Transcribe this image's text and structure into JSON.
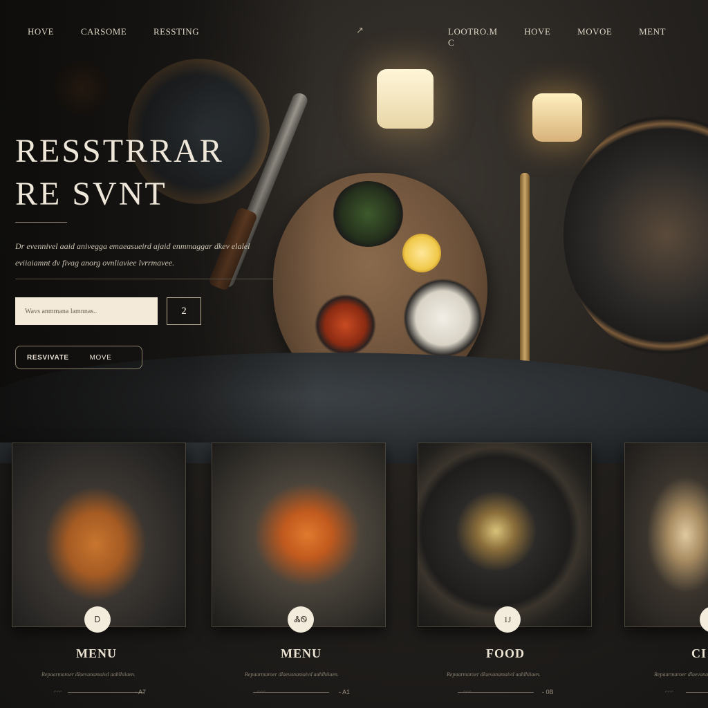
{
  "nav": {
    "left": [
      "HOVE",
      "CARSOME",
      "RESSTING"
    ],
    "right": [
      "LOOTRO.M",
      "HOVE",
      "MOVOE",
      "MENT",
      "C"
    ]
  },
  "hero": {
    "title_line1": "RESSTRRAR",
    "title_line2": "RE SVNT",
    "description": "Dr evennivel aaid anivegga emaeasueird ajaid enmmaggar dkev elalel eviiaiamnt dv fivag anorg ovnliaviee lvrrmavee.",
    "search_placeholder": "Wavs anmmana lamnnas..",
    "count": "2",
    "button_reserve": "RESVIVATE",
    "button_move": "MOVE"
  },
  "cards": [
    {
      "badge": "Ꭰ",
      "title": "MENU",
      "desc": "Repaarmaroer dlaevanamaivd aahlhiiaen.",
      "meta_left": "⌐⌐⌐",
      "meta_right": "- A7"
    },
    {
      "badge": "ᏜᏫ",
      "title": "MENU",
      "desc": "Repaarmaroer dlaevanamaivd aahlhiiaen.",
      "meta_left": "⌐⌐⌐",
      "meta_right": "- A1"
    },
    {
      "badge": "1J",
      "title": "FOOD",
      "desc": "Repaarmaroer dlaevanamaivd aahlhiiaen.",
      "meta_left": "⌐⌐⌐",
      "meta_right": "- 0B"
    },
    {
      "badge": "",
      "title": "CI",
      "desc": "Repaarmaroer dlaevanam",
      "meta_left": "⌐⌐⌐",
      "meta_right": ""
    }
  ],
  "icons": {
    "nav_arrow": "arrow-icon"
  },
  "colors": {
    "background": "#1a1816",
    "accent": "#f3ead9",
    "text": "#e9e2d4"
  }
}
